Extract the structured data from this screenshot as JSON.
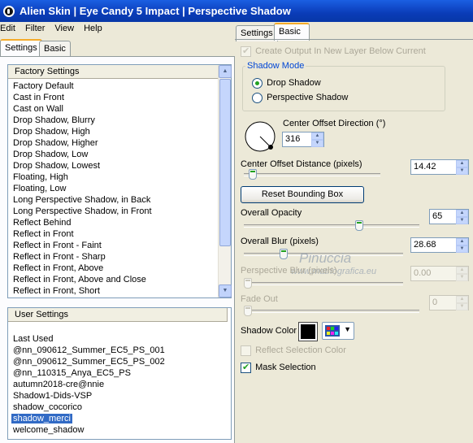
{
  "window": {
    "title": "Alien Skin | Eye Candy 5 Impact | Perspective Shadow"
  },
  "menu": [
    "Edit",
    "Filter",
    "View",
    "Help"
  ],
  "left_tabs": {
    "settings": "Settings",
    "basic": "Basic"
  },
  "factory": {
    "header": "Factory Settings",
    "items": [
      "Factory Default",
      "Cast in Front",
      "Cast on Wall",
      "Drop Shadow, Blurry",
      "Drop Shadow, High",
      "Drop Shadow, Higher",
      "Drop Shadow, Low",
      "Drop Shadow, Lowest",
      "Floating, High",
      "Floating, Low",
      "Long Perspective Shadow, in Back",
      "Long Perspective Shadow, in Front",
      "Reflect Behind",
      "Reflect in Front",
      "Reflect in Front - Faint",
      "Reflect in Front - Sharp",
      "Reflect in Front, Above",
      "Reflect in Front, Above and Close",
      "Reflect in Front, Short"
    ]
  },
  "user": {
    "header": "User Settings",
    "items": [
      "Last Used",
      "@nn_090612_Summer_EC5_PS_001",
      "@nn_090612_Summer_EC5_PS_002",
      "@nn_110315_Anya_EC5_PS",
      "autumn2018-cre@nnie",
      "Shadow1-Dids-VSP",
      "shadow_cocorico",
      "shadow_merci",
      "welcome_shadow"
    ],
    "selected_index": 7
  },
  "right_tabs": {
    "settings": "Settings",
    "basic": "Basic"
  },
  "basic": {
    "create_output": "Create Output In New Layer Below Current",
    "shadow_mode_legend": "Shadow Mode",
    "mode_drop": "Drop Shadow",
    "mode_perspective": "Perspective Shadow",
    "center_offset_direction_label": "Center Offset Direction (°)",
    "center_offset_direction_value": "316",
    "center_offset_distance_label": "Center Offset Distance (pixels)",
    "center_offset_distance_value": "14.42",
    "reset_button": "Reset Bounding Box",
    "overall_opacity_label": "Overall Opacity",
    "overall_opacity_value": "65",
    "overall_blur_label": "Overall Blur (pixels)",
    "overall_blur_value": "28.68",
    "perspective_blur_label": "Perspective Blur (pixels)",
    "perspective_blur_value": "0.00",
    "fade_out_label": "Fade Out",
    "fade_out_value": "0",
    "shadow_color_label": "Shadow Color",
    "reflect_selection_color": "Reflect Selection Color",
    "mask_selection": "Mask Selection"
  },
  "watermark": {
    "line1": "Pinuccia",
    "line2": "www.matriografica.eu"
  }
}
